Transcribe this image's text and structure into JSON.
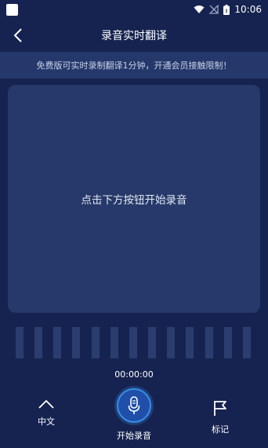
{
  "status_bar": {
    "time": "10:06"
  },
  "header": {
    "title": "录音实时翻译"
  },
  "notice": {
    "text": "免费版可实时录制翻译1分钟，开通会员接触限制！"
  },
  "panel": {
    "hint": "点击下方按钮开始录音"
  },
  "timer": {
    "value": "00:00:00"
  },
  "bottom": {
    "language_label": "中文",
    "record_label": "开始录音",
    "mark_label": "标记"
  },
  "colors": {
    "background": "#162350",
    "panel": "#26396a",
    "accent": "#3a8fe8"
  }
}
